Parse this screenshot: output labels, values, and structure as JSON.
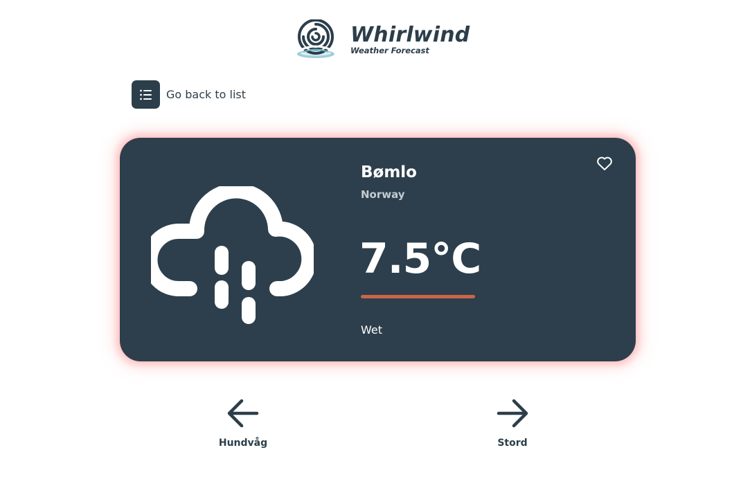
{
  "header": {
    "logo_title": "Whirlwind",
    "logo_subtitle": "Weather Forecast",
    "logo_icon": "swirl-logo-icon"
  },
  "back_link": {
    "label": "Go back to list",
    "icon": "list-icon"
  },
  "weather": {
    "city": "Bømlo",
    "country": "Norway",
    "temperature": "7.5°C",
    "condition": "Wet",
    "icon": "rain-cloud-icon",
    "favorite_icon": "heart-icon",
    "colors": {
      "card_bg": "#2d3f4c",
      "temp_bar": "#c9664a",
      "glow": "#ff8a8a"
    }
  },
  "navigation": {
    "prev_label": "Hundvåg",
    "next_label": "Stord",
    "prev_icon": "arrow-left-icon",
    "next_icon": "arrow-right-icon"
  }
}
